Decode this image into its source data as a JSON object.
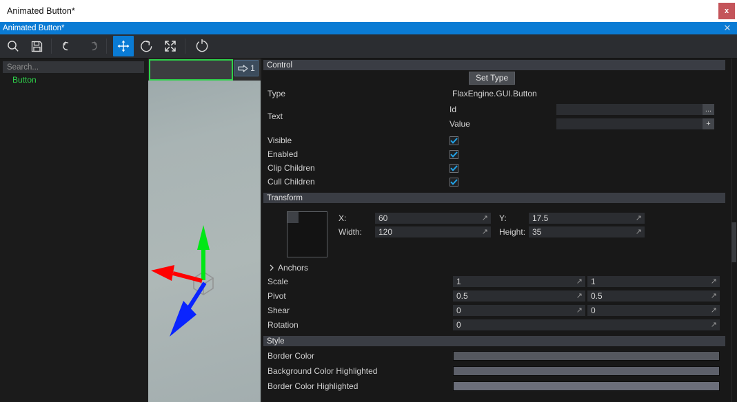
{
  "window": {
    "os_title": "Animated Button*",
    "os_close_label": "x",
    "app_title": "Animated Button*",
    "app_close_label": "✕"
  },
  "toolbar": {
    "items": [
      {
        "name": "search-icon",
        "label": "Search",
        "state": "normal"
      },
      {
        "name": "save-icon",
        "label": "Save",
        "state": "normal"
      },
      {
        "name": "undo-icon",
        "label": "Undo",
        "state": "normal"
      },
      {
        "name": "redo-icon",
        "label": "Redo",
        "state": "disabled"
      },
      {
        "name": "translate-gizmo-icon",
        "label": "Translate",
        "state": "active"
      },
      {
        "name": "rotate-gizmo-icon",
        "label": "Rotate",
        "state": "normal"
      },
      {
        "name": "scale-gizmo-icon",
        "label": "Scale",
        "state": "normal"
      },
      {
        "name": "reload-icon",
        "label": "Reload",
        "state": "normal"
      }
    ]
  },
  "tree": {
    "search_placeholder": "Search...",
    "search_value": "",
    "items": [
      {
        "label": "Button",
        "color": "#2ed14a"
      }
    ]
  },
  "viewport": {
    "badge_count": "1",
    "gizmo": {
      "x_axis_color": "#ff0000",
      "y_axis_color": "#00e715",
      "z_axis_color": "#0a24ff"
    },
    "selection_outline_color": "#2ed14a"
  },
  "properties": {
    "control": {
      "header": "Control",
      "set_type_button": "Set Type",
      "rows": [
        {
          "label": "Type",
          "value": "FlaxEngine.GUI.Button"
        }
      ],
      "text_label": "Text",
      "text_sub_rows": [
        {
          "label": "Id",
          "value": "",
          "button": "..."
        },
        {
          "label": "Value",
          "value": "",
          "button": "+"
        }
      ],
      "checkboxes": [
        {
          "label": "Visible",
          "checked": true
        },
        {
          "label": "Enabled",
          "checked": true
        },
        {
          "label": "Clip Children",
          "checked": true
        },
        {
          "label": "Cull Children",
          "checked": true
        }
      ]
    },
    "transform": {
      "header": "Transform",
      "x_label": "X:",
      "x_value": "60",
      "y_label": "Y:",
      "y_value": "17.5",
      "width_label": "Width:",
      "width_value": "120",
      "height_label": "Height:",
      "height_value": "35",
      "anchors_label": "Anchors",
      "anchors_expanded": false,
      "rows": [
        {
          "label": "Scale",
          "v1": "1",
          "v2": "1"
        },
        {
          "label": "Pivot",
          "v1": "0.5",
          "v2": "0.5"
        },
        {
          "label": "Shear",
          "v1": "0",
          "v2": "0"
        }
      ],
      "rotation_label": "Rotation",
      "rotation_value": "0"
    },
    "style": {
      "header": "Style",
      "rows": [
        {
          "label": "Border Color",
          "color": "#55585f"
        },
        {
          "label": "Background Color Highlighted",
          "color": "#5d606a"
        },
        {
          "label": "Border Color Highlighted",
          "color": "#6b6e7a"
        }
      ]
    }
  }
}
